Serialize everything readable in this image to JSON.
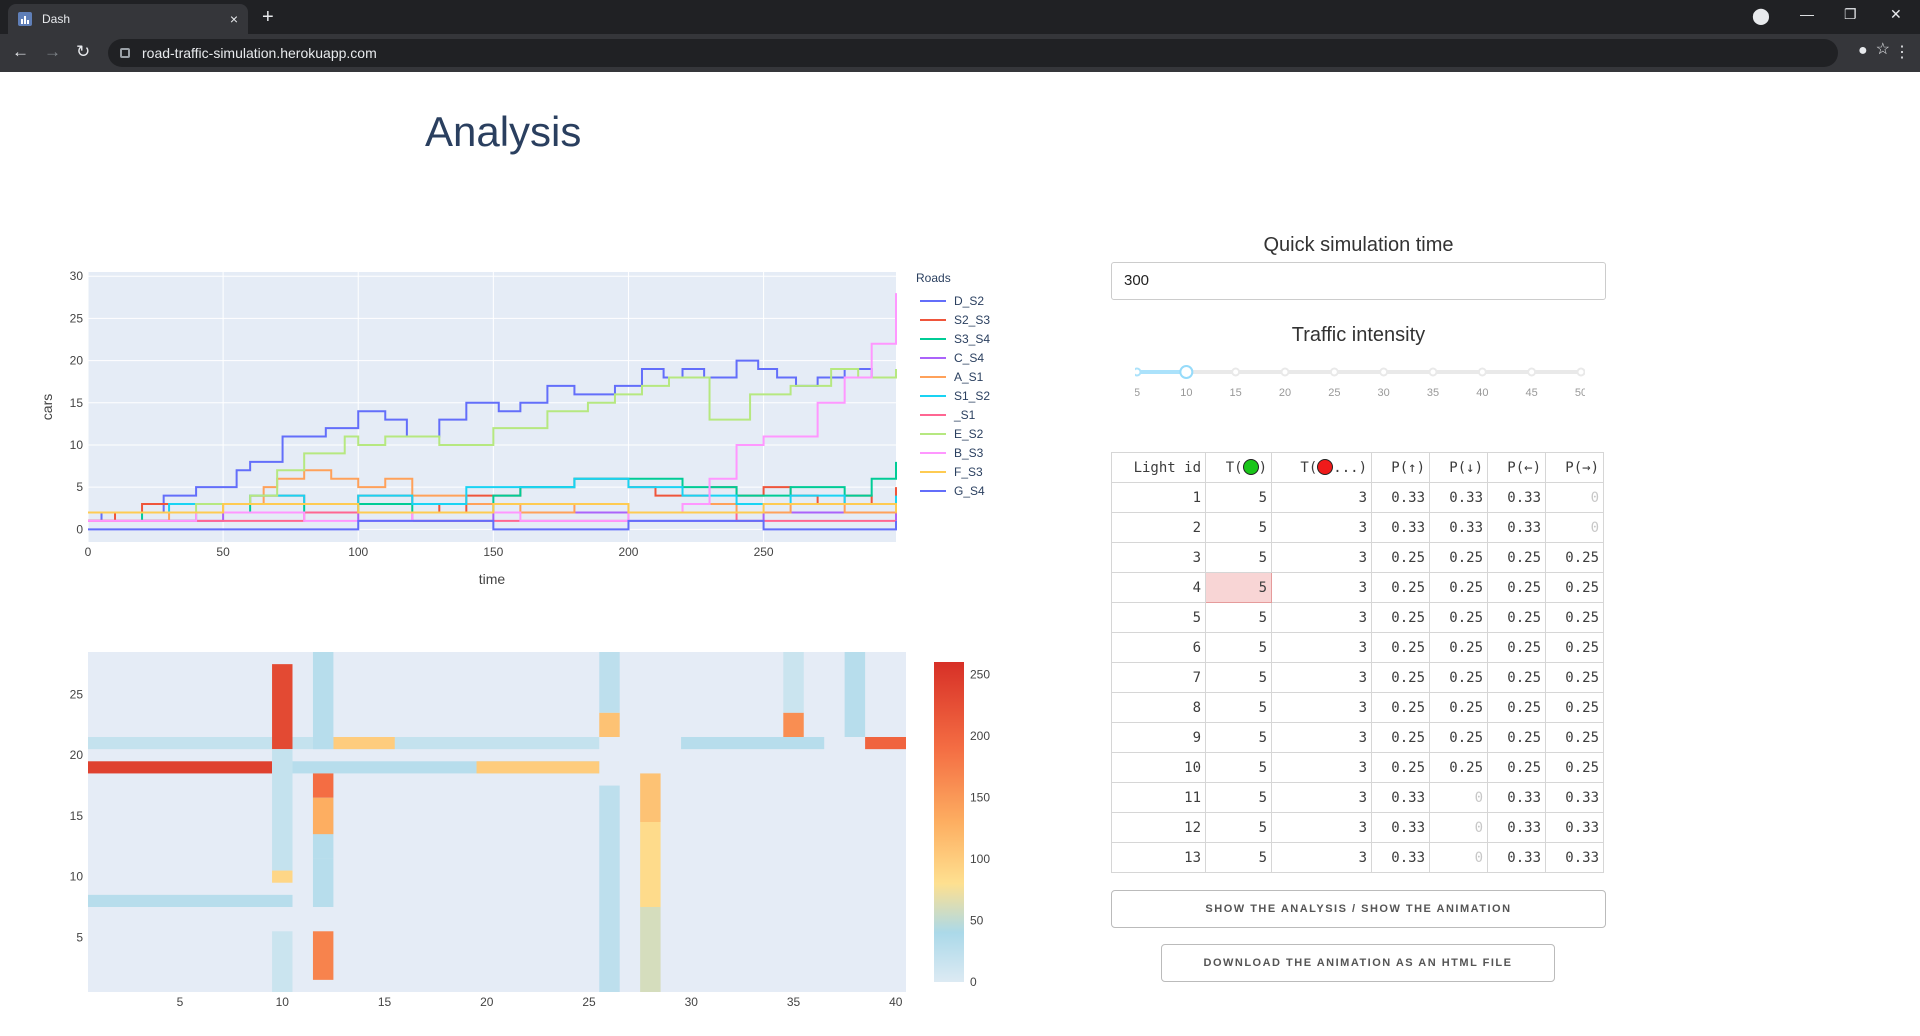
{
  "browser": {
    "tab_title": "Dash",
    "tab_close": "×",
    "new_tab": "+",
    "url": "road-traffic-simulation.herokuapp.com",
    "win_min": "—",
    "win_max": "❐",
    "win_close": "✕"
  },
  "page": {
    "title": "Analysis",
    "quick_sim_label": "Quick simulation time",
    "quick_sim_value": "300",
    "intensity_label": "Traffic intensity",
    "intensity_ticks": [
      "5",
      "10",
      "15",
      "20",
      "25",
      "30",
      "35",
      "40",
      "45",
      "50"
    ],
    "intensity_value": 10,
    "btn_toggle": "SHOW THE ANALYSIS / SHOW THE ANIMATION",
    "btn_download": "DOWNLOAD THE ANIMATION AS AN HTML FILE"
  },
  "table": {
    "headers": [
      "Light id",
      "T(green)",
      "T(red...)",
      "P(↑)",
      "P(↓)",
      "P(←)",
      "P(→)"
    ],
    "rows": [
      [
        "1",
        "5",
        "3",
        "0.33",
        "0.33",
        "0.33",
        "0"
      ],
      [
        "2",
        "5",
        "3",
        "0.33",
        "0.33",
        "0.33",
        "0"
      ],
      [
        "3",
        "5",
        "3",
        "0.25",
        "0.25",
        "0.25",
        "0.25"
      ],
      [
        "4",
        "5",
        "3",
        "0.25",
        "0.25",
        "0.25",
        "0.25"
      ],
      [
        "5",
        "5",
        "3",
        "0.25",
        "0.25",
        "0.25",
        "0.25"
      ],
      [
        "6",
        "5",
        "3",
        "0.25",
        "0.25",
        "0.25",
        "0.25"
      ],
      [
        "7",
        "5",
        "3",
        "0.25",
        "0.25",
        "0.25",
        "0.25"
      ],
      [
        "8",
        "5",
        "3",
        "0.25",
        "0.25",
        "0.25",
        "0.25"
      ],
      [
        "9",
        "5",
        "3",
        "0.25",
        "0.25",
        "0.25",
        "0.25"
      ],
      [
        "10",
        "5",
        "3",
        "0.25",
        "0.25",
        "0.25",
        "0.25"
      ],
      [
        "11",
        "5",
        "3",
        "0.33",
        "0",
        "0.33",
        "0.33"
      ],
      [
        "12",
        "5",
        "3",
        "0.33",
        "0",
        "0.33",
        "0.33"
      ],
      [
        "13",
        "5",
        "3",
        "0.33",
        "0",
        "0.33",
        "0.33"
      ]
    ]
  },
  "chart_data": [
    {
      "type": "line",
      "xlabel": "time",
      "ylabel": "cars",
      "xlim": [
        0,
        299
      ],
      "ylim": [
        -1.5,
        30.5
      ],
      "xticks": [
        0,
        50,
        100,
        150,
        200,
        250
      ],
      "yticks": [
        0,
        5,
        10,
        15,
        20,
        25,
        30
      ],
      "legend_title": "Roads",
      "legend_position": "right",
      "series": [
        {
          "name": "D_S2",
          "color": "#636efa",
          "x": [
            0,
            5,
            15,
            28,
            40,
            55,
            60,
            72,
            80,
            88,
            95,
            100,
            110,
            118,
            130,
            140,
            152,
            160,
            170,
            180,
            195,
            205,
            213,
            220,
            228,
            240,
            248,
            255,
            262,
            270,
            280,
            290,
            299
          ],
          "y": [
            1,
            2,
            2,
            4,
            5,
            7,
            8,
            11,
            11,
            12,
            12,
            14,
            13,
            11,
            13,
            15,
            14,
            15,
            17,
            16,
            17,
            19,
            18,
            19,
            18,
            20,
            19,
            18,
            17,
            18,
            19,
            18,
            18
          ]
        },
        {
          "name": "S2_S3",
          "color": "#ef553b",
          "x": [
            0,
            10,
            20,
            40,
            60,
            80,
            100,
            120,
            130,
            140,
            160,
            180,
            190,
            200,
            210,
            220,
            230,
            240,
            250,
            260,
            270,
            280,
            290,
            299
          ],
          "y": [
            1,
            2,
            3,
            3,
            4,
            3,
            4,
            3,
            2,
            4,
            5,
            6,
            6,
            5,
            4,
            4,
            5,
            4,
            5,
            4,
            3,
            4,
            3,
            5
          ]
        },
        {
          "name": "S3_S4",
          "color": "#00cc96",
          "x": [
            0,
            20,
            40,
            60,
            80,
            100,
            120,
            140,
            150,
            160,
            180,
            200,
            220,
            240,
            260,
            280,
            290,
            299
          ],
          "y": [
            2,
            1,
            2,
            3,
            2,
            3,
            2,
            2,
            4,
            5,
            6,
            6,
            5,
            4,
            5,
            4,
            6,
            8
          ]
        },
        {
          "name": "C_S4",
          "color": "#ab63fa",
          "x": [
            0,
            50,
            100,
            150,
            200,
            250,
            299
          ],
          "y": [
            1,
            2,
            1,
            2,
            1,
            2,
            1
          ]
        },
        {
          "name": "A_S1",
          "color": "#ffa15a",
          "x": [
            0,
            30,
            50,
            65,
            70,
            80,
            90,
            100,
            110,
            120,
            140,
            160,
            180,
            200,
            220,
            240,
            260,
            280,
            299
          ],
          "y": [
            1,
            2,
            3,
            5,
            6,
            7,
            6,
            5,
            6,
            4,
            3,
            2,
            3,
            2,
            3,
            2,
            3,
            2,
            3
          ]
        },
        {
          "name": "S1_S2",
          "color": "#19d3f3",
          "x": [
            0,
            30,
            60,
            80,
            100,
            120,
            140,
            160,
            180,
            200,
            220,
            240,
            260,
            280,
            299
          ],
          "y": [
            2,
            3,
            4,
            3,
            4,
            3,
            5,
            5,
            6,
            5,
            4,
            3,
            4,
            3,
            4
          ]
        },
        {
          "name": "_S1",
          "color": "#ff6692",
          "x": [
            0,
            40,
            80,
            120,
            160,
            200,
            240,
            280,
            299
          ],
          "y": [
            1,
            1,
            2,
            1,
            1,
            2,
            1,
            1,
            1
          ]
        },
        {
          "name": "E_S2",
          "color": "#b6e880",
          "x": [
            0,
            20,
            40,
            60,
            70,
            80,
            95,
            100,
            110,
            130,
            150,
            170,
            185,
            195,
            205,
            215,
            230,
            245,
            260,
            275,
            285,
            299
          ],
          "y": [
            2,
            2,
            3,
            4,
            7,
            9,
            11,
            10,
            11,
            10,
            12,
            14,
            15,
            16,
            17,
            18,
            13,
            16,
            17,
            19,
            18,
            19
          ]
        },
        {
          "name": "B_S3",
          "color": "#ff97ff",
          "x": [
            0,
            40,
            80,
            120,
            160,
            200,
            220,
            230,
            240,
            250,
            260,
            270,
            280,
            290,
            299
          ],
          "y": [
            1,
            2,
            1,
            2,
            1,
            2,
            3,
            6,
            10,
            11,
            11,
            15,
            18,
            22,
            28
          ]
        },
        {
          "name": "F_S3",
          "color": "#fecb52",
          "x": [
            0,
            50,
            100,
            150,
            200,
            250,
            299
          ],
          "y": [
            2,
            3,
            2,
            3,
            2,
            3,
            2
          ]
        },
        {
          "name": "G_S4",
          "color": "#636efa",
          "x": [
            0,
            50,
            100,
            150,
            200,
            250,
            299
          ],
          "y": [
            0,
            0,
            1,
            0,
            1,
            0,
            1
          ]
        }
      ]
    },
    {
      "type": "heatmap",
      "xlim": [
        1,
        40
      ],
      "ylim": [
        1,
        28
      ],
      "xticks": [
        5,
        10,
        15,
        20,
        25,
        30,
        35,
        40
      ],
      "yticks": [
        5,
        10,
        15,
        20,
        25
      ],
      "colorscale": "RdYlBu-reversed",
      "colorbar_ticks": [
        0,
        50,
        100,
        150,
        200,
        250
      ],
      "zmax": 260,
      "cells": [
        {
          "x": 10,
          "y": [
            21,
            27
          ],
          "v": 230
        },
        {
          "x": 10,
          "y": [
            11,
            20
          ],
          "v": 20
        },
        {
          "x": 10,
          "y": [
            10,
            10
          ],
          "v": 90
        },
        {
          "x": 10,
          "y": [
            1,
            5
          ],
          "v": 15
        },
        {
          "x": 12,
          "y": [
            12,
            18
          ],
          "v": 30
        },
        {
          "x": 12,
          "y": [
            17,
            18
          ],
          "v": 190
        },
        {
          "x": 12,
          "y": [
            14,
            16
          ],
          "v": 130
        },
        {
          "x": 12,
          "y": [
            2,
            5
          ],
          "v": 170
        },
        {
          "x": 12,
          "y": [
            21,
            28
          ],
          "v": 30
        },
        {
          "x": 12,
          "y": [
            8,
            11
          ],
          "v": 30
        },
        {
          "x": 26,
          "y": [
            22,
            23
          ],
          "v": 110
        },
        {
          "x": 26,
          "y": [
            1,
            17
          ],
          "v": 25
        },
        {
          "x": 26,
          "y": [
            24,
            28
          ],
          "v": 25
        },
        {
          "x": 28,
          "y": [
            15,
            18
          ],
          "v": 110
        },
        {
          "x": 28,
          "y": [
            8,
            14
          ],
          "v": 85
        },
        {
          "x": 28,
          "y": [
            1,
            7
          ],
          "v": 60
        },
        {
          "x": 38,
          "y": [
            22,
            28
          ],
          "v": 30
        },
        {
          "x": 35,
          "y": [
            22,
            23
          ],
          "v": 160
        },
        {
          "x": 35,
          "y": [
            24,
            28
          ],
          "v": 15
        }
      ],
      "row_bands": [
        {
          "y": 19,
          "x": [
            1,
            9
          ],
          "v": 240
        },
        {
          "y": 19,
          "x": [
            10,
            25
          ],
          "v": 30
        },
        {
          "y": 19,
          "x": [
            20,
            25
          ],
          "v": 100
        },
        {
          "y": 21,
          "x": [
            1,
            25
          ],
          "v": 20
        },
        {
          "y": 21,
          "x": [
            13,
            15
          ],
          "v": 100
        },
        {
          "y": 21,
          "x": [
            30,
            36
          ],
          "v": 30
        },
        {
          "y": 21,
          "x": [
            39,
            40
          ],
          "v": 200
        },
        {
          "y": 8,
          "x": [
            1,
            10
          ],
          "v": 30
        }
      ]
    }
  ]
}
